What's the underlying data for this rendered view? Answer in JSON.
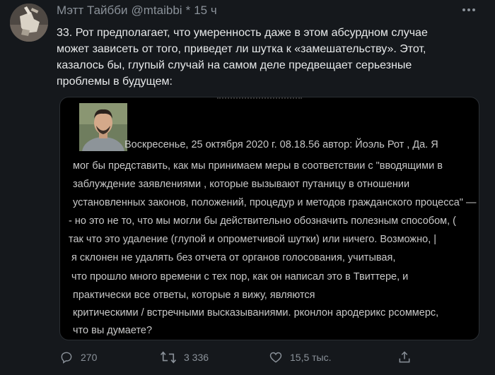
{
  "tweet": {
    "author_name": "Мэтт Тайбби",
    "handle": "@mtaibbi",
    "separator": "*",
    "time": "15 ч",
    "body_lines": [
      "33. Рот предполагает, что умеренность даже в этом абсурдном случае",
      "может зависеть от того, приведет ли шутка к «замешательству». Этот,",
      "казалось бы, глупый случай на самом деле предвещает серьезные",
      "проблемы в будущем:"
    ]
  },
  "embed": {
    "lines": [
      "Воскресенье, 25 октября 2020 г. 08.18.56 автор: Йоэль Рот , Да. Я",
      "мог бы представить, как мы принимаем меры в соответствии с \"вводящими в",
      "заблуждение заявлениями , которые вызывают путаницу в отношении",
      "установленных законов, положений, процедур и методов гражданского процесса\" —",
      "- но это не то, что мы могли бы действительно обозначить полезным способом, (",
      "так что это удаление (глупой и опрометчивой шутки) или ничего. Возможно, |",
      "я склонен не удалять без отчета от органов голосования, учитывая,",
      "что прошло много времени с тех пор, как он написал это в Твиттере, и",
      "практически все ответы, которые я вижу, являются",
      "критическими / встречными высказываниями. рконлон ародерикс рсоммерс,",
      "что вы думаете?"
    ]
  },
  "actions": {
    "replies": "270",
    "retweets": "3 336",
    "likes": "15,5 тыс."
  }
}
